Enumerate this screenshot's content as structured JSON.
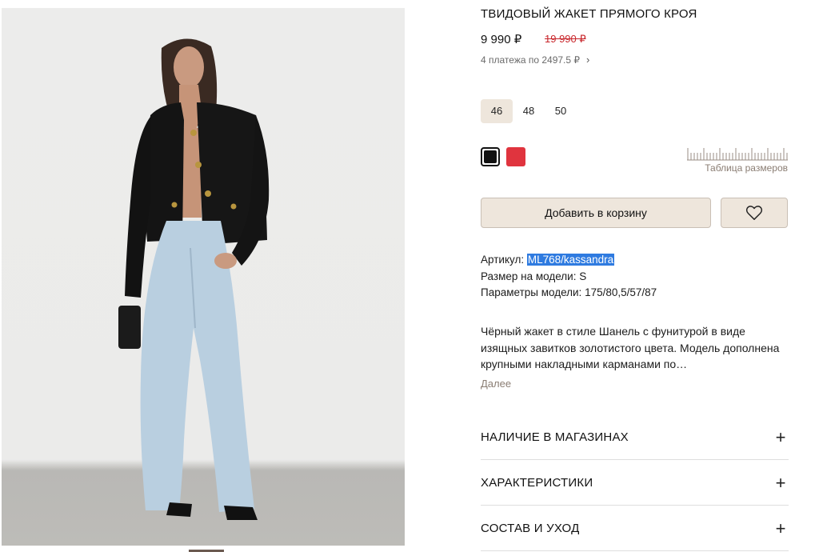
{
  "product": {
    "title": "ТВИДОВЫЙ ЖАКЕТ ПРЯМОГО КРОЯ",
    "price": "9 990 ₽",
    "old_price": "19 990 ₽",
    "installments": "4 платежа по 2497.5 ₽",
    "installments_icon": "chevron-right-icon"
  },
  "sizes": [
    {
      "label": "46",
      "selected": true
    },
    {
      "label": "48",
      "selected": false
    },
    {
      "label": "50",
      "selected": false
    }
  ],
  "colors": [
    {
      "name": "black",
      "hex": "#111111",
      "selected": true
    },
    {
      "name": "red",
      "hex": "#e0343e",
      "selected": false
    }
  ],
  "size_table": {
    "label": "Таблица размеров",
    "icon": "ruler-icon"
  },
  "actions": {
    "add_to_cart": "Добавить в корзину",
    "favorite_icon": "heart-icon"
  },
  "specs": {
    "article_label": "Артикул:",
    "article_value": "ML768/kassandra",
    "model_size": "Размер на модели: S",
    "model_params": "Параметры модели: 175/80,5/57/87"
  },
  "description": {
    "text": "Чёрный жакет в стиле Шанель с фунитурой в виде изящных завитков золотистого цвета. Модель дополнена крупными накладными карманами по…",
    "more": "Далее"
  },
  "accordions": [
    {
      "label": "НАЛИЧИЕ В МАГАЗИНАХ",
      "icon": "plus-icon"
    },
    {
      "label": "ХАРАКТЕРИСТИКИ",
      "icon": "plus-icon"
    },
    {
      "label": "СОСТАВ И УХОД",
      "icon": "plus-icon"
    }
  ],
  "theme": {
    "accent_bg": "#eee6dc",
    "sale_red": "#c8262b",
    "selection_blue": "#2f7be0"
  }
}
